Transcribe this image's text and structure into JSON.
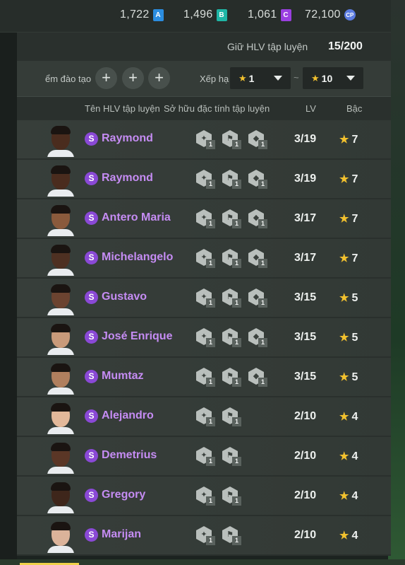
{
  "currency": {
    "a_value": "1,722",
    "a_label": "A",
    "b_value": "1,496",
    "b_label": "B",
    "c_value": "1,061",
    "c_label": "C",
    "cp_value": "72,100",
    "cp_label": "CP",
    "colors": {
      "a": "#2b8de0",
      "b": "#1fb6a6",
      "c": "#9a3fe0"
    }
  },
  "holder": {
    "label": "Giữ HLV tập luyện",
    "count": "15/200"
  },
  "filter": {
    "label": "ểm đào tạo",
    "plus_symbol": "+",
    "rank_label": "Xếp hạ",
    "min_rank": "1",
    "tilde": "~",
    "max_rank": "10"
  },
  "headers": {
    "coach_name": "Tên HLV tập luyện",
    "traits": "Sở hữu đặc tính tập luyện",
    "lv": "LV",
    "grade": "Bậc"
  },
  "coaches": [
    {
      "badge": "S",
      "name": "Raymond",
      "trait_levels": [
        "1",
        "1",
        "1"
      ],
      "lv": "3/19",
      "grade": "7",
      "skin": "#4a2c1e"
    },
    {
      "badge": "S",
      "name": "Raymond",
      "trait_levels": [
        "1",
        "1",
        "1"
      ],
      "lv": "3/19",
      "grade": "7",
      "skin": "#4a2c1e"
    },
    {
      "badge": "S",
      "name": "Antero Maria",
      "trait_levels": [
        "1",
        "1",
        "1"
      ],
      "lv": "3/17",
      "grade": "7",
      "skin": "#8a5a3c"
    },
    {
      "badge": "S",
      "name": "Michelangelo",
      "trait_levels": [
        "1",
        "1",
        "1"
      ],
      "lv": "3/17",
      "grade": "7",
      "skin": "#4e3022"
    },
    {
      "badge": "S",
      "name": "Gustavo",
      "trait_levels": [
        "1",
        "1",
        "1"
      ],
      "lv": "3/15",
      "grade": "5",
      "skin": "#6b4330"
    },
    {
      "badge": "S",
      "name": "José Enrique",
      "trait_levels": [
        "1",
        "1",
        "1"
      ],
      "lv": "3/15",
      "grade": "5",
      "skin": "#c99a7a"
    },
    {
      "badge": "S",
      "name": "Mumtaz",
      "trait_levels": [
        "1",
        "1",
        "1"
      ],
      "lv": "3/15",
      "grade": "5",
      "skin": "#b07f5e"
    },
    {
      "badge": "S",
      "name": "Alejandro",
      "trait_levels": [
        "1",
        "1"
      ],
      "lv": "2/10",
      "grade": "4",
      "skin": "#e2b89a"
    },
    {
      "badge": "S",
      "name": "Demetrius",
      "trait_levels": [
        "1",
        "1"
      ],
      "lv": "2/10",
      "grade": "4",
      "skin": "#5a3626"
    },
    {
      "badge": "S",
      "name": "Gregory",
      "trait_levels": [
        "1",
        "1"
      ],
      "lv": "2/10",
      "grade": "4",
      "skin": "#3e261b"
    },
    {
      "badge": "S",
      "name": "Marijan",
      "trait_levels": [
        "1",
        "1"
      ],
      "lv": "2/10",
      "grade": "4",
      "skin": "#dbb39a"
    }
  ]
}
